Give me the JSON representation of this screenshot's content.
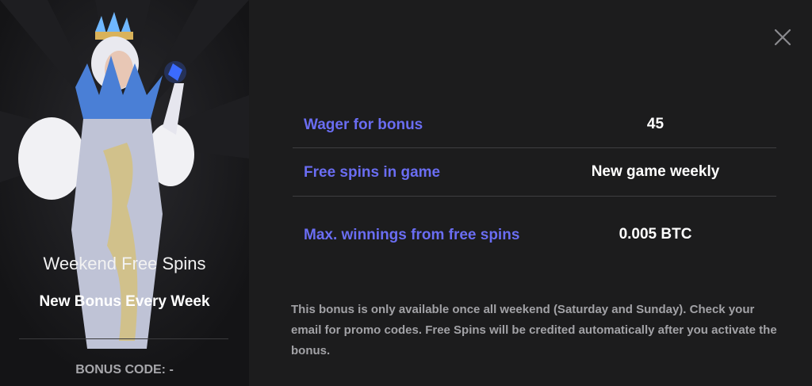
{
  "promo": {
    "title": "Weekend Free Spins",
    "subtitle": "New Bonus Every Week",
    "bonus_code_label": "BONUS CODE: -"
  },
  "details": [
    {
      "label": "Wager for bonus",
      "value": "45"
    },
    {
      "label": "Free spins in game",
      "value": "New game weekly"
    },
    {
      "label": "Max. winnings from free spins",
      "value": "0.005 BTC"
    }
  ],
  "description": "This bonus is only available once all weekend (Saturday and Sunday). Check your email for promo codes. Free Spins will be credited automatically after you activate the bonus.",
  "icons": {
    "close": "close-icon"
  },
  "colors": {
    "accent": "#6a6df2",
    "background": "#1c1c1d",
    "panel": "#141416"
  }
}
